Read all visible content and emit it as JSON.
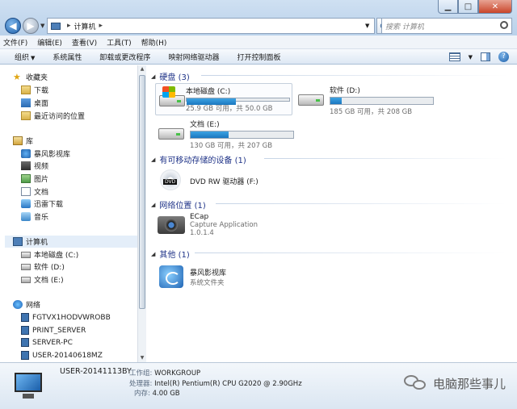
{
  "address": {
    "root": "计算机",
    "search_placeholder": "搜索 计算机"
  },
  "menu": [
    "文件(F)",
    "编辑(E)",
    "查看(V)",
    "工具(T)",
    "帮助(H)"
  ],
  "commands": [
    "组织",
    "系统属性",
    "卸载或更改程序",
    "映射网络驱动器",
    "打开控制面板"
  ],
  "nav": {
    "favorites": "收藏夹",
    "fav_items": [
      "下载",
      "桌面",
      "最近访问的位置"
    ],
    "libraries": "库",
    "lib_items": [
      "暴风影视库",
      "视频",
      "图片",
      "文档",
      "迅雷下载",
      "音乐"
    ],
    "computer": "计算机",
    "computer_items": [
      "本地磁盘 (C:)",
      "软件 (D:)",
      "文档 (E:)"
    ],
    "network": "网络",
    "network_items": [
      "FGTVX1HODVWROBB",
      "PRINT_SERVER",
      "SERVER-PC",
      "USER-20140618MZ"
    ]
  },
  "groups": {
    "hdd": "硬盘 (3)",
    "removable": "有可移动存储的设备 (1)",
    "netloc": "网络位置 (1)",
    "other": "其他 (1)"
  },
  "drives": [
    {
      "name": "本地磁盘 (C:)",
      "free": "25.9 GB 可用，共 50.0 GB",
      "used_fraction": 0.482
    },
    {
      "name": "软件 (D:)",
      "free": "185 GB 可用，共 208 GB",
      "used_fraction": 0.11
    },
    {
      "name": "文档 (E:)",
      "free": "130 GB 可用，共 207 GB",
      "used_fraction": 0.372
    }
  ],
  "dvd": {
    "name": "DVD RW 驱动器 (F:)",
    "label": "DVD"
  },
  "ecap": {
    "name": "ECap",
    "desc": "Capture Application",
    "version": "1.0.1.4"
  },
  "storm": {
    "name": "暴风影视库",
    "desc": "系统文件夹"
  },
  "details": {
    "computer_name": "USER-20141113BY",
    "workgroup_label": "工作组:",
    "workgroup": "WORKGROUP",
    "cpu_label": "处理器:",
    "cpu": "Intel(R) Pentium(R) CPU G2020 @ 2.90GHz",
    "mem_label": "内存:",
    "mem": "4.00 GB"
  },
  "watermark": "电脑那些事儿",
  "colors": {
    "accent": "#1e3287",
    "bar_fill": "#2a8ed4"
  }
}
